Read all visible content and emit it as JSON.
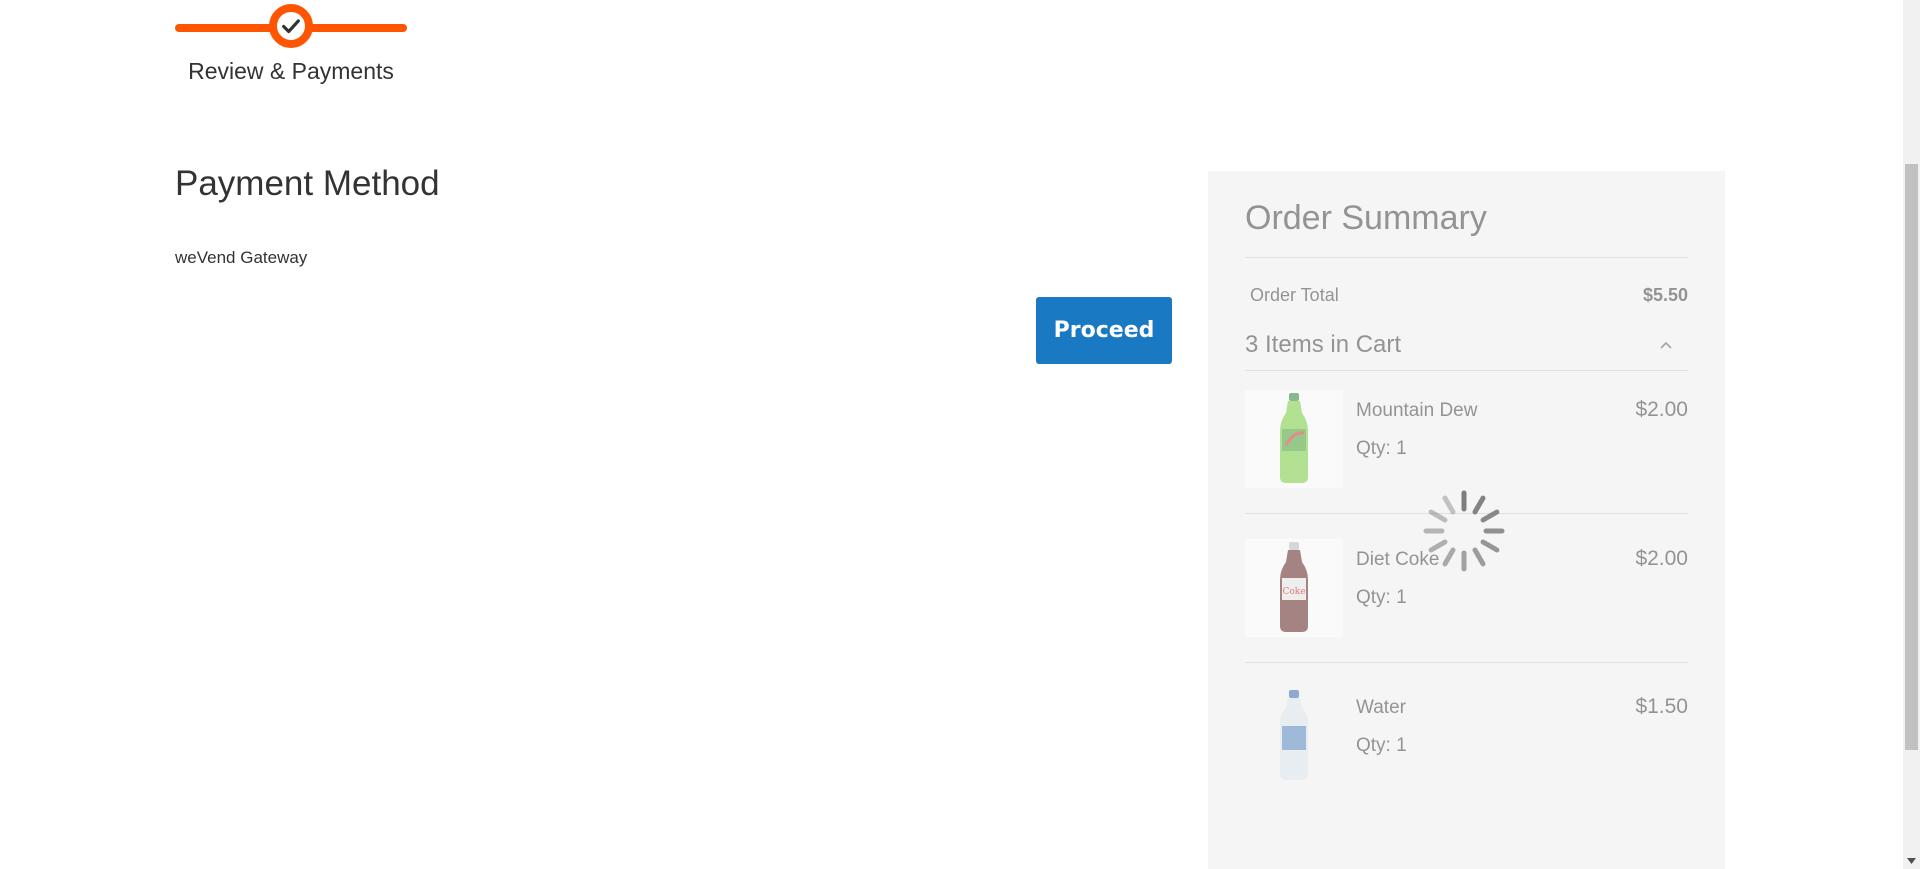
{
  "progress": {
    "step_label": "Review & Payments",
    "accent_color": "#ff5501",
    "icon": "check-icon"
  },
  "payment": {
    "title": "Payment Method",
    "gateway": "weVend Gateway",
    "proceed_label": "Proceed",
    "button_color": "#1979c3"
  },
  "summary": {
    "title": "Order Summary",
    "total_label": "Order Total",
    "total_value": "$5.50",
    "items_title": "3 Items in Cart",
    "toggle_icon": "chevron-up-icon",
    "items": [
      {
        "name": "Mountain Dew",
        "qty": "Qty: 1",
        "price": "$2.00",
        "icon": "mountain-dew-bottle-icon"
      },
      {
        "name": "Diet Coke",
        "qty": "Qty: 1",
        "price": "$2.00",
        "icon": "diet-coke-bottle-icon"
      },
      {
        "name": "Water",
        "qty": "Qty: 1",
        "price": "$1.50",
        "icon": "water-bottle-icon"
      }
    ]
  },
  "loader": {
    "icon": "loading-spinner-icon"
  }
}
